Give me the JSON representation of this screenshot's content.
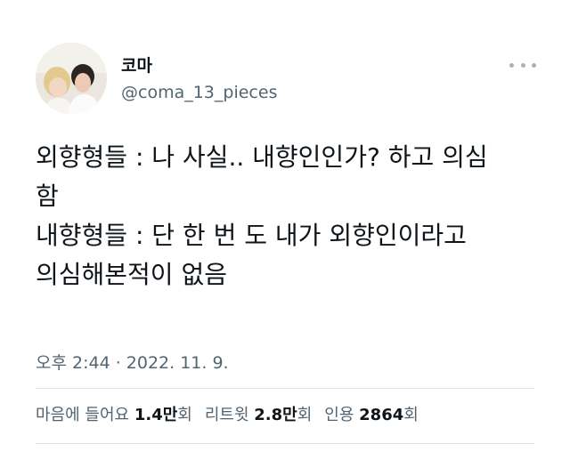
{
  "user": {
    "display_name": "코마",
    "handle": "@coma_13_pieces",
    "avatar_icon": "profile-photo-two-people"
  },
  "menu": {
    "icon": "more-options-icon"
  },
  "tweet": {
    "lines": [
      "외향형들 : 나 사실.. 내향인인가? 하고 의심",
      "함",
      "내향형들 : 단 한 번 도 내가 외향인이라고",
      "의심해본적이 없음"
    ],
    "timestamp": "오후 2:44 · 2022. 11. 9."
  },
  "stats": {
    "likes": {
      "label": "마음에 들어요",
      "number": "1.4만",
      "suffix": "회"
    },
    "retweets": {
      "label": "리트윗",
      "number": "2.8만",
      "suffix": "회"
    },
    "quotes": {
      "label": "인용",
      "number": "2864",
      "suffix": "회"
    }
  },
  "colors": {
    "text": "#0f1419",
    "secondary": "#536471",
    "divider": "#dfe4e8"
  }
}
